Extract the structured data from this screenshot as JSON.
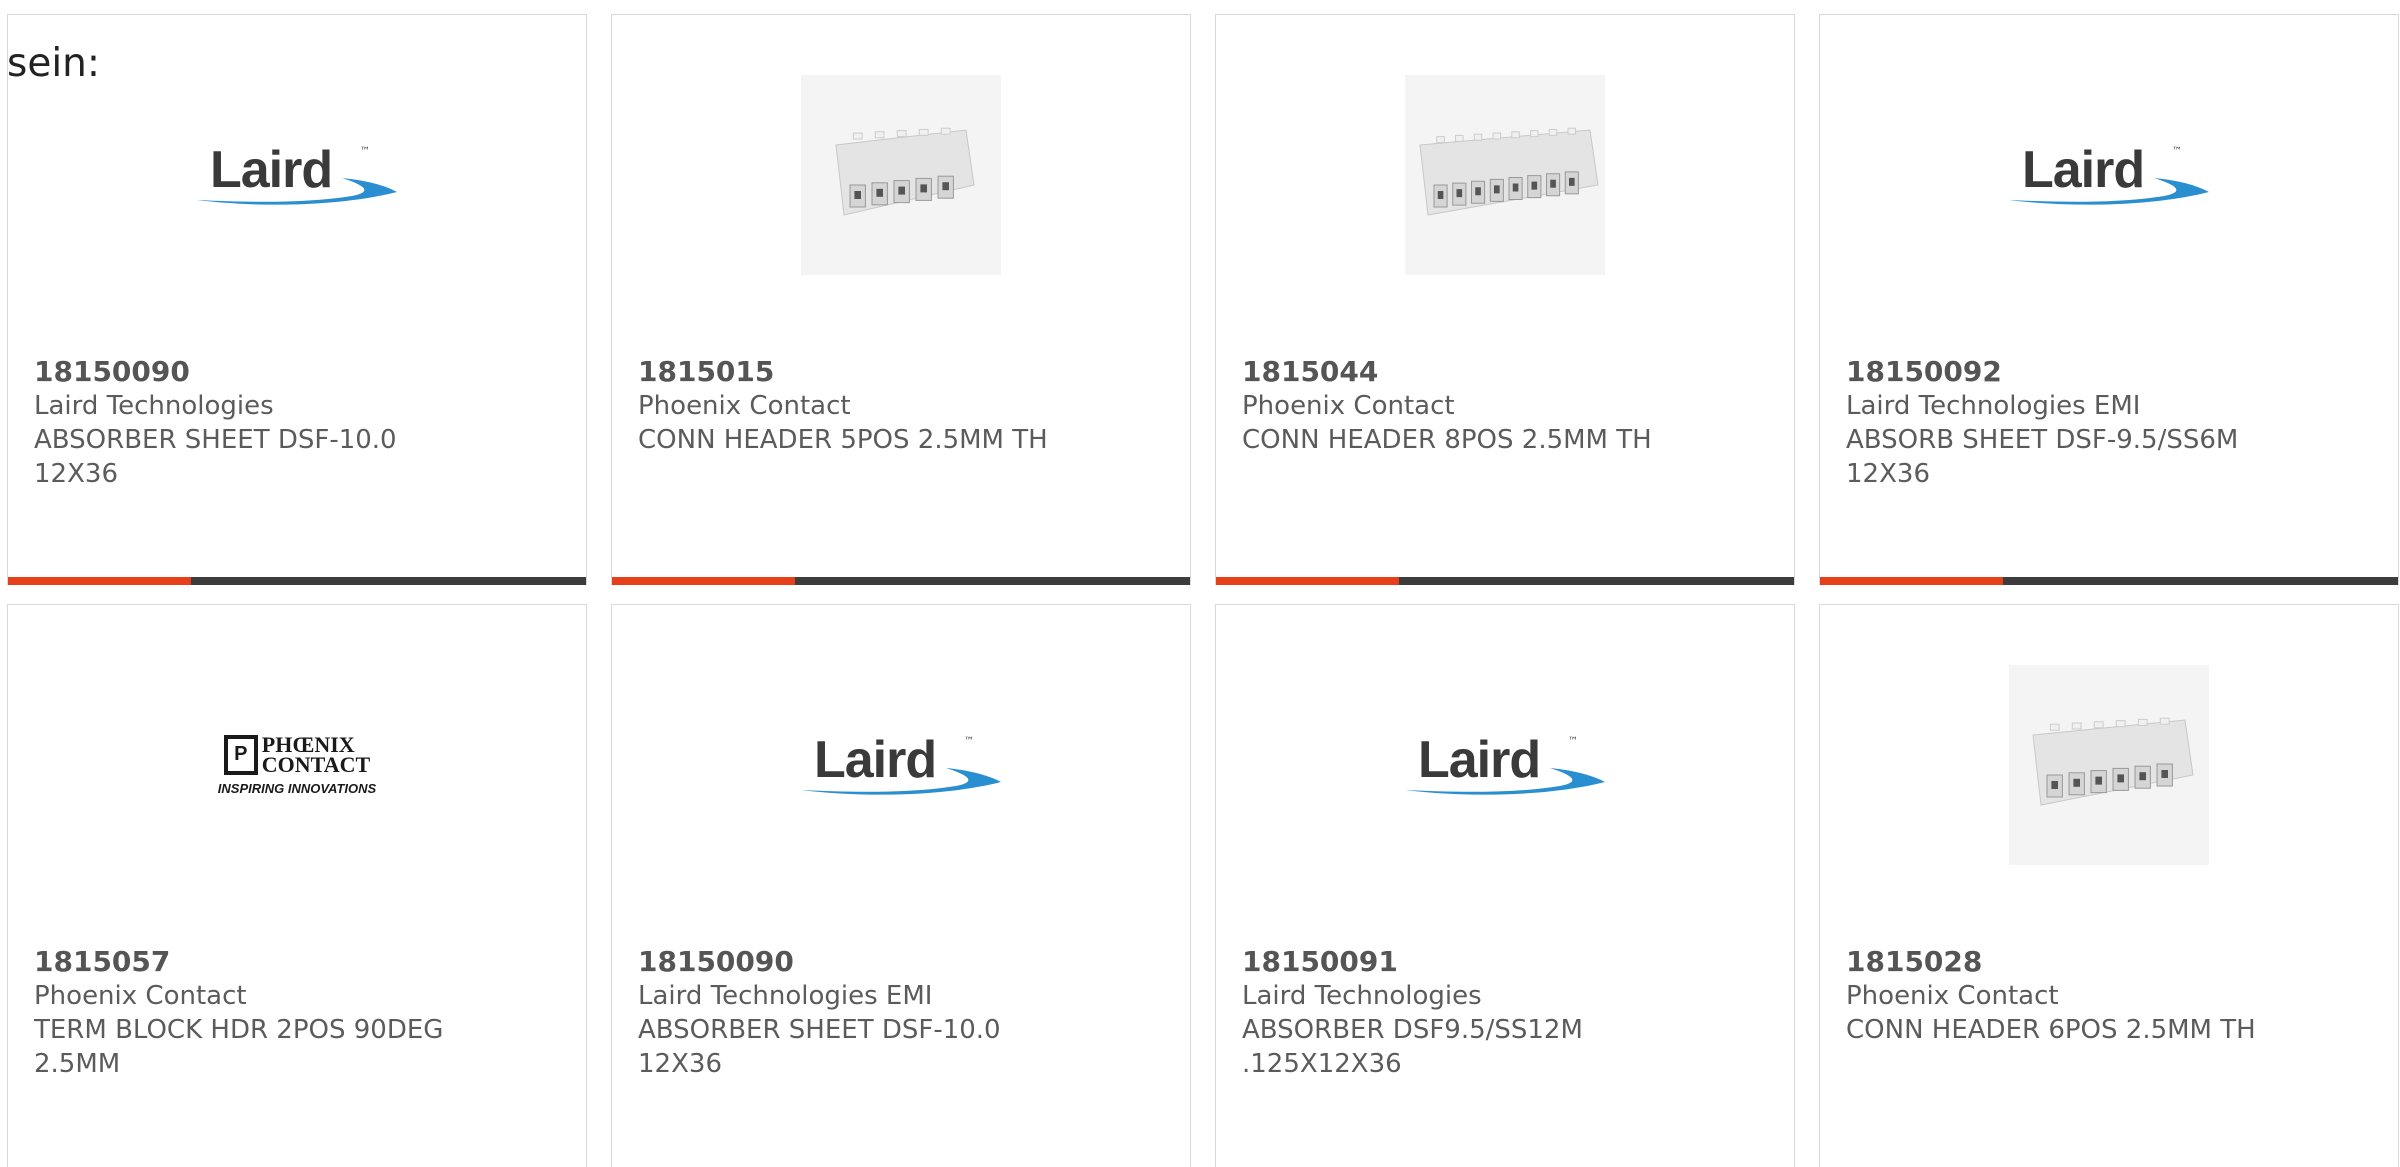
{
  "intro_text": "sein:",
  "products": [
    {
      "part": "18150090",
      "manufacturer": "Laird Technologies",
      "description": "ABSORBER SHEET DSF-10.0\n12X36",
      "image": "laird-logo",
      "pins": 0
    },
    {
      "part": "1815015",
      "manufacturer": "Phoenix Contact",
      "description": "CONN HEADER 5POS 2.5MM TH",
      "image": "connector-photo",
      "pins": 5
    },
    {
      "part": "1815044",
      "manufacturer": "Phoenix Contact",
      "description": "CONN HEADER 8POS 2.5MM TH",
      "image": "connector-photo",
      "pins": 8
    },
    {
      "part": "18150092",
      "manufacturer": "Laird Technologies EMI",
      "description": "ABSORB SHEET DSF-9.5/SS6M\n12X36",
      "image": "laird-logo",
      "pins": 0
    },
    {
      "part": "1815057",
      "manufacturer": "Phoenix Contact",
      "description": "TERM BLOCK HDR 2POS 90DEG\n2.5MM",
      "image": "phoenix-logo",
      "pins": 0
    },
    {
      "part": "18150090",
      "manufacturer": "Laird Technologies EMI",
      "description": "ABSORBER SHEET DSF-10.0\n12X36",
      "image": "laird-logo",
      "pins": 0
    },
    {
      "part": "18150091",
      "manufacturer": "Laird Technologies",
      "description": "ABSORBER DSF9.5/SS12M\n.125X12X36",
      "image": "laird-logo",
      "pins": 0
    },
    {
      "part": "1815028",
      "manufacturer": "Phoenix Contact",
      "description": "CONN HEADER 6POS 2.5MM TH",
      "image": "connector-photo",
      "pins": 6
    }
  ],
  "logos": {
    "laird_word": "Laird",
    "laird_tm": "™",
    "phoenix_mark": "P",
    "phoenix_line1": "PHŒNIX",
    "phoenix_line2": "CONTACT",
    "phoenix_tagline": "INSPIRING INNOVATIONS"
  },
  "colors": {
    "accent": "#e6401a",
    "bar_dark": "#3c3c3c",
    "laird_blue": "#2a8fd0"
  }
}
